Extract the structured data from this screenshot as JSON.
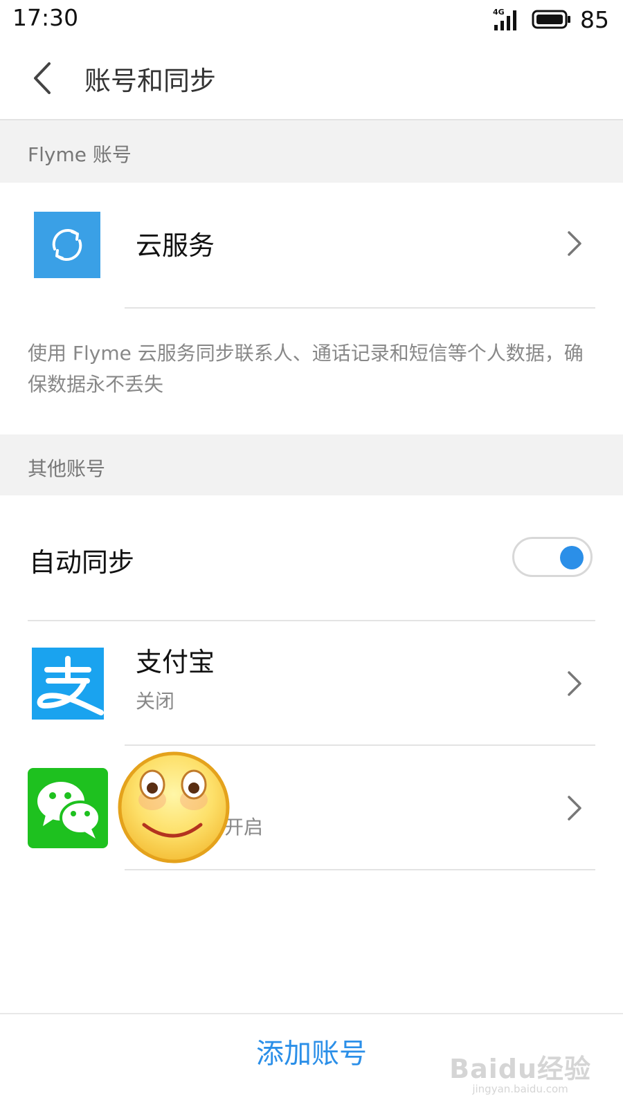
{
  "status_bar": {
    "time": "17:30",
    "network": "4G",
    "battery_percent": "85"
  },
  "header": {
    "title": "账号和同步"
  },
  "flyme_section": {
    "header": "Flyme 账号",
    "cloud_service": {
      "label": "云服务"
    },
    "description": "使用 Flyme 云服务同步联系人、通话记录和短信等个人数据，确保数据永不丢失"
  },
  "other_section": {
    "header": "其他账号",
    "auto_sync": {
      "label": "自动同步",
      "enabled": true
    },
    "accounts": [
      {
        "name": "支付宝",
        "status": "关闭"
      },
      {
        "name": "",
        "status": "已开启"
      }
    ]
  },
  "footer": {
    "add_account": "添加账号"
  },
  "watermark": {
    "logo": "Baidu经验",
    "url": "jingyan.baidu.com"
  },
  "colors": {
    "accent": "#2b8fe8",
    "cloud_icon": "#3aa0e6",
    "alipay": "#1aa3ef",
    "wechat": "#1ec11f"
  }
}
